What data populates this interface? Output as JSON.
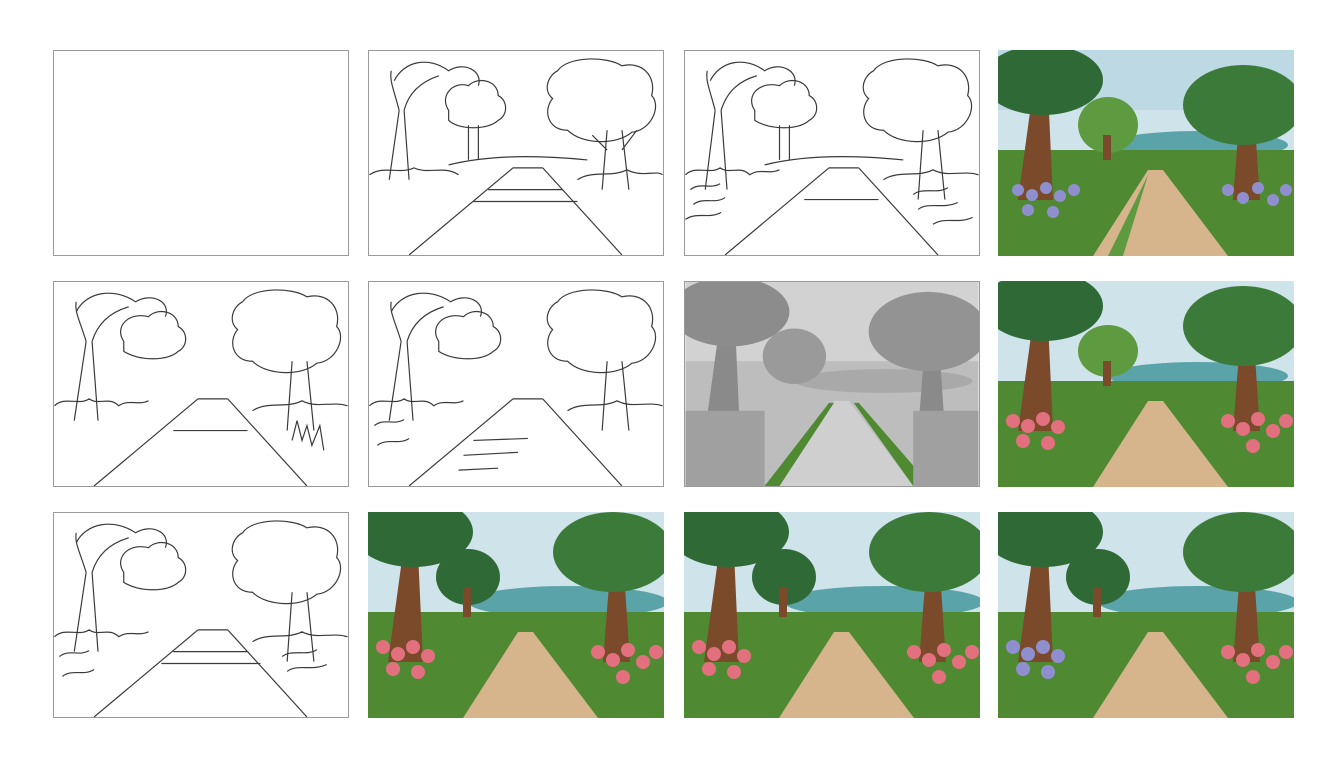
{
  "title": "",
  "panels": [
    {
      "row": 1,
      "col": 1,
      "stage": "blank-canvas",
      "type": "blank"
    },
    {
      "row": 1,
      "col": 2,
      "stage": "rough-sketch",
      "type": "lineart"
    },
    {
      "row": 1,
      "col": 3,
      "stage": "detailed-sketch",
      "type": "lineart"
    },
    {
      "row": 1,
      "col": 4,
      "stage": "color-purple-flowers",
      "type": "color"
    },
    {
      "row": 2,
      "col": 1,
      "stage": "clean-lineart",
      "type": "lineart"
    },
    {
      "row": 2,
      "col": 2,
      "stage": "refined-lineart",
      "type": "lineart"
    },
    {
      "row": 2,
      "col": 3,
      "stage": "grayscale-values",
      "type": "grayscale"
    },
    {
      "row": 2,
      "col": 4,
      "stage": "color-pink-flowers",
      "type": "color"
    },
    {
      "row": 3,
      "col": 1,
      "stage": "lineart",
      "type": "lineart"
    },
    {
      "row": 3,
      "col": 2,
      "stage": "color-pink-flowers",
      "type": "color"
    },
    {
      "row": 3,
      "col": 3,
      "stage": "color-pink-flowers",
      "type": "color"
    },
    {
      "row": 3,
      "col": 4,
      "stage": "color-mixed-flowers",
      "type": "color"
    }
  ],
  "colors": {
    "line": "#3a3a3a",
    "sky": "#cfe3ea",
    "foliage_dark": "#2f6a36",
    "foliage_light": "#5e9a3f",
    "trunk": "#7a4a2a",
    "path": "#d6b48c",
    "grass": "#4f8a32",
    "water": "#5aa3a8",
    "flower_pink": "#e2707f",
    "flower_purple": "#8f8fd0"
  }
}
